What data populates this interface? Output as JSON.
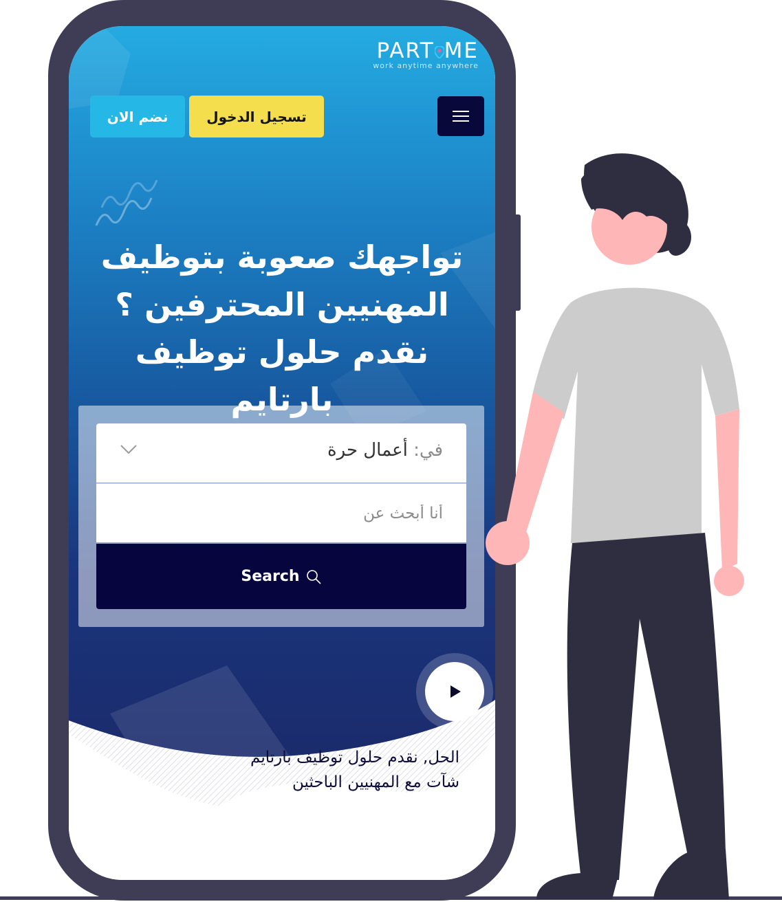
{
  "logo": {
    "text_part1": "PART",
    "text_part2": "ME",
    "tagline": "work anytime anywhere"
  },
  "header": {
    "login_label": "تسجيل الدخول",
    "join_label": "نضم الان",
    "menu_icon": "hamburger-icon"
  },
  "hero": {
    "line1": "تواجهك صعوبة بتوظيف",
    "line2": "المهنيين المحترفين ؟",
    "line3": "نقدم حلول توظيف بارتايم"
  },
  "search": {
    "category_prefix": "في:",
    "category_value": "أعمال حرة",
    "placeholder": "أنا أبحث عن",
    "button_label": "Search"
  },
  "bottom": {
    "text_line1": "الحل, نقدم حلول توظيف بارتايم",
    "text_line2": "شآت مع المهنيين الباحثين"
  },
  "colors": {
    "gradient_top": "#24abe1",
    "gradient_bottom": "#1b2a6a",
    "login_yellow": "#f5de4e",
    "join_cyan": "#25b7e6",
    "navy": "#07053d",
    "phone_frame": "#3f3d56"
  }
}
